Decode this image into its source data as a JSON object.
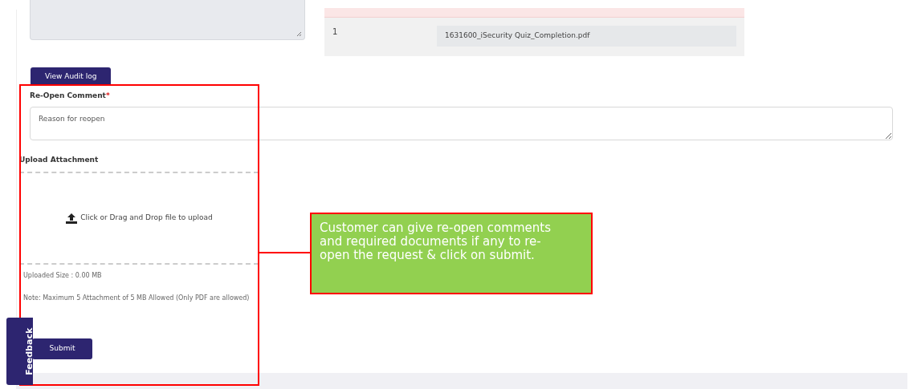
{
  "previous_comment": {
    "disabled": true
  },
  "attachments_table": {
    "rows": [
      {
        "index": "1",
        "file_name": "1631600_iSecurity Quiz_Completion.pdf"
      }
    ]
  },
  "audit_button": "View Audit log",
  "reopen_comment": {
    "label": "Re-Open Comment",
    "required_mark": "*",
    "placeholder": "Reason for reopen"
  },
  "upload": {
    "label": "Upload Attachment",
    "dropzone_text": "Click or Drag and Drop file to upload",
    "uploaded_size": "Uploaded Size : 0.00  MB",
    "note": "Note: Maximum 5 Attachment of 5 MB Allowed (Only PDF are allowed)"
  },
  "submit_button": "Submit",
  "feedback_tab": "Feedback",
  "annotation": {
    "text": "Customer can give re-open comments and required documents if any to re-open the request & click on submit."
  }
}
